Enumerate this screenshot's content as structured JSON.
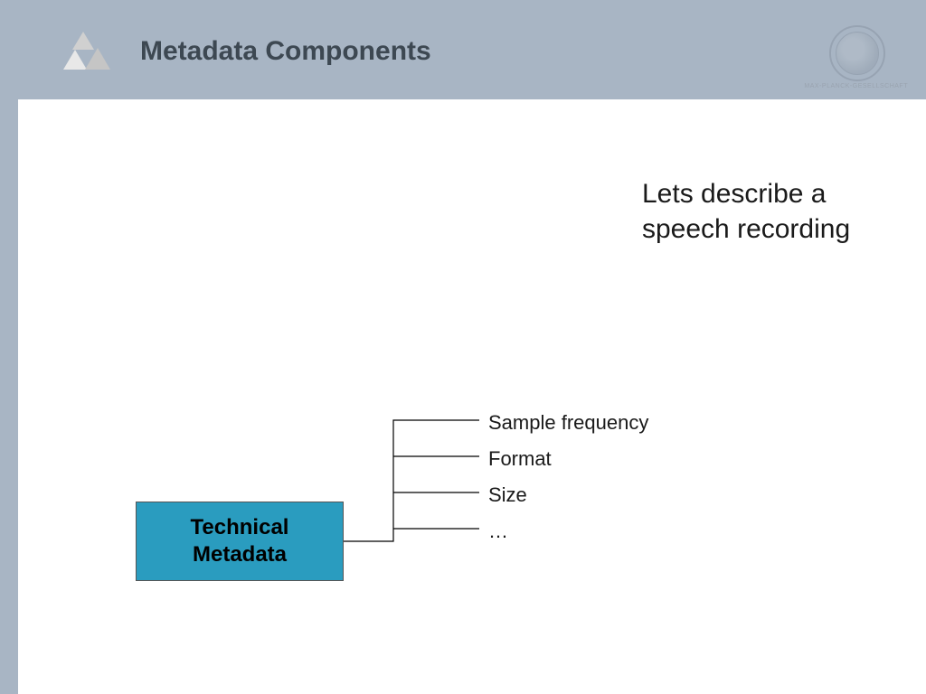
{
  "header": {
    "title": "Metadata Components",
    "seal_caption": "MAX-PLANCK-GESELLSCHAFT"
  },
  "body": {
    "intro_line1": "Lets describe a",
    "intro_line2": "speech recording"
  },
  "diagram": {
    "box_line1": "Technical",
    "box_line2": "Metadata",
    "items": [
      "Sample frequency",
      "Format",
      "Size",
      "…"
    ]
  }
}
